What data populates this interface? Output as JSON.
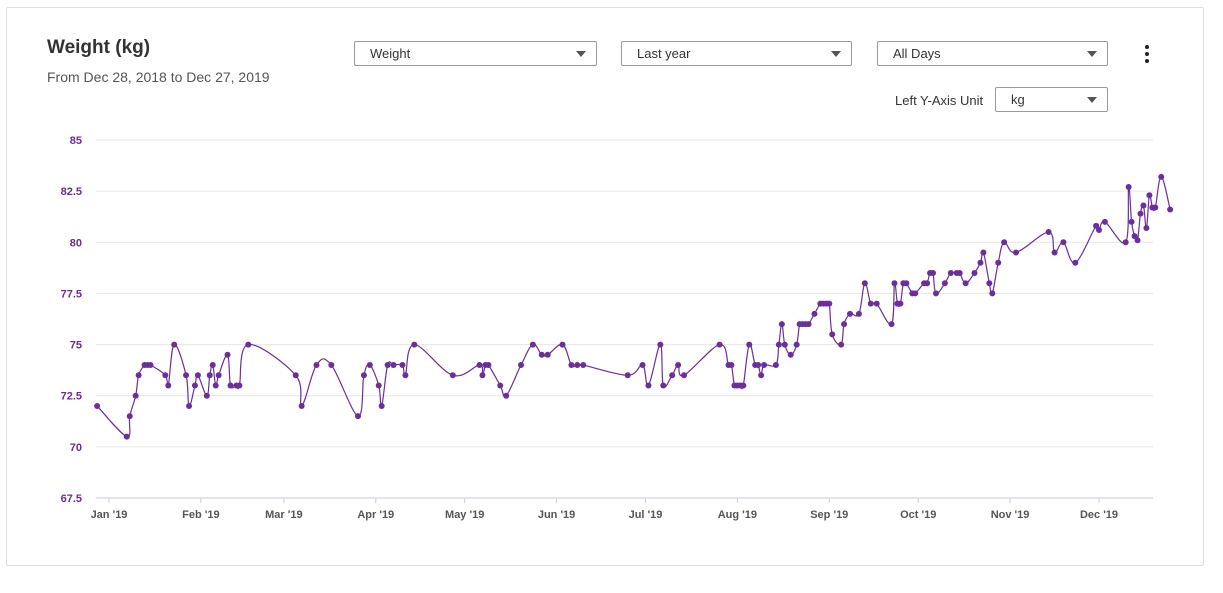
{
  "header": {
    "title": "Weight (kg)",
    "subtitle": "From Dec 28, 2018 to Dec 27, 2019"
  },
  "controls": {
    "metric": "Weight",
    "range": "Last year",
    "days": "All Days",
    "unit_label": "Left Y-Axis Unit",
    "unit": "kg"
  },
  "icons": {
    "menu": "more-vertical-icon"
  },
  "colors": {
    "series": "#6a2f9a",
    "y_ticks": "#6c2d8f",
    "grid": "#e6e6e6",
    "axis": "#c9c9e8"
  },
  "chart_data": {
    "type": "line",
    "title": "Weight (kg)",
    "ylim": [
      67.5,
      85
    ],
    "y_ticks": [
      "67.5",
      "70",
      "72.5",
      "75",
      "77.5",
      "80",
      "82.5",
      "85"
    ],
    "x_tick_labels": [
      "Jan '19",
      "Feb '19",
      "Mar '19",
      "Apr '19",
      "May '19",
      "Jun '19",
      "Jul '19",
      "Aug '19",
      "Sep '19",
      "Oct '19",
      "Nov '19",
      "Dec '19"
    ],
    "x_tick_dates": [
      "2019-01-01",
      "2019-02-01",
      "2019-03-01",
      "2019-04-01",
      "2019-05-01",
      "2019-06-01",
      "2019-07-01",
      "2019-08-01",
      "2019-09-01",
      "2019-10-01",
      "2019-11-01",
      "2019-12-01"
    ],
    "grid": true,
    "series": [
      {
        "points": [
          [
            "2018-12-28",
            72.0
          ],
          [
            "2019-01-07",
            70.5
          ],
          [
            "2019-01-08",
            71.5
          ],
          [
            "2019-01-10",
            72.5
          ],
          [
            "2019-01-11",
            73.5
          ],
          [
            "2019-01-13",
            74.0
          ],
          [
            "2019-01-14",
            74.0
          ],
          [
            "2019-01-15",
            74.0
          ],
          [
            "2019-01-20",
            73.5
          ],
          [
            "2019-01-21",
            73.0
          ],
          [
            "2019-01-23",
            75.0
          ],
          [
            "2019-01-27",
            73.5
          ],
          [
            "2019-01-28",
            72.0
          ],
          [
            "2019-01-30",
            73.0
          ],
          [
            "2019-01-31",
            73.5
          ],
          [
            "2019-02-03",
            72.5
          ],
          [
            "2019-02-04",
            73.5
          ],
          [
            "2019-02-05",
            74.0
          ],
          [
            "2019-02-06",
            73.0
          ],
          [
            "2019-02-07",
            73.5
          ],
          [
            "2019-02-10",
            74.5
          ],
          [
            "2019-02-11",
            73.0
          ],
          [
            "2019-02-13",
            73.0
          ],
          [
            "2019-02-14",
            73.0
          ],
          [
            "2019-02-17",
            75.0
          ],
          [
            "2019-03-05",
            73.5
          ],
          [
            "2019-03-07",
            72.0
          ],
          [
            "2019-03-12",
            74.0
          ],
          [
            "2019-03-17",
            74.0
          ],
          [
            "2019-03-26",
            71.5
          ],
          [
            "2019-03-28",
            73.5
          ],
          [
            "2019-03-30",
            74.0
          ],
          [
            "2019-04-02",
            73.0
          ],
          [
            "2019-04-03",
            72.0
          ],
          [
            "2019-04-05",
            74.0
          ],
          [
            "2019-04-07",
            74.0
          ],
          [
            "2019-04-10",
            74.0
          ],
          [
            "2019-04-11",
            73.5
          ],
          [
            "2019-04-14",
            75.0
          ],
          [
            "2019-04-27",
            73.5
          ],
          [
            "2019-05-06",
            74.0
          ],
          [
            "2019-05-07",
            73.5
          ],
          [
            "2019-05-08",
            74.0
          ],
          [
            "2019-05-09",
            74.0
          ],
          [
            "2019-05-13",
            73.0
          ],
          [
            "2019-05-15",
            72.5
          ],
          [
            "2019-05-20",
            74.0
          ],
          [
            "2019-05-24",
            75.0
          ],
          [
            "2019-05-27",
            74.5
          ],
          [
            "2019-05-29",
            74.5
          ],
          [
            "2019-06-03",
            75.0
          ],
          [
            "2019-06-06",
            74.0
          ],
          [
            "2019-06-08",
            74.0
          ],
          [
            "2019-06-10",
            74.0
          ],
          [
            "2019-06-25",
            73.5
          ],
          [
            "2019-06-30",
            74.0
          ],
          [
            "2019-07-02",
            73.0
          ],
          [
            "2019-07-06",
            75.0
          ],
          [
            "2019-07-07",
            73.0
          ],
          [
            "2019-07-10",
            73.5
          ],
          [
            "2019-07-12",
            74.0
          ],
          [
            "2019-07-14",
            73.5
          ],
          [
            "2019-07-26",
            75.0
          ],
          [
            "2019-07-29",
            74.0
          ],
          [
            "2019-07-30",
            74.0
          ],
          [
            "2019-07-31",
            73.0
          ],
          [
            "2019-08-01",
            73.0
          ],
          [
            "2019-08-02",
            73.0
          ],
          [
            "2019-08-03",
            73.0
          ],
          [
            "2019-08-05",
            75.0
          ],
          [
            "2019-08-07",
            74.0
          ],
          [
            "2019-08-08",
            74.0
          ],
          [
            "2019-08-09",
            73.5
          ],
          [
            "2019-08-10",
            74.0
          ],
          [
            "2019-08-14",
            74.0
          ],
          [
            "2019-08-15",
            75.0
          ],
          [
            "2019-08-16",
            76.0
          ],
          [
            "2019-08-17",
            75.0
          ],
          [
            "2019-08-19",
            74.5
          ],
          [
            "2019-08-21",
            75.0
          ],
          [
            "2019-08-22",
            76.0
          ],
          [
            "2019-08-23",
            76.0
          ],
          [
            "2019-08-24",
            76.0
          ],
          [
            "2019-08-25",
            76.0
          ],
          [
            "2019-08-27",
            76.5
          ],
          [
            "2019-08-29",
            77.0
          ],
          [
            "2019-08-30",
            77.0
          ],
          [
            "2019-08-31",
            77.0
          ],
          [
            "2019-09-01",
            77.0
          ],
          [
            "2019-09-02",
            75.5
          ],
          [
            "2019-09-05",
            75.0
          ],
          [
            "2019-09-06",
            76.0
          ],
          [
            "2019-09-08",
            76.5
          ],
          [
            "2019-09-11",
            76.5
          ],
          [
            "2019-09-13",
            78.0
          ],
          [
            "2019-09-15",
            77.0
          ],
          [
            "2019-09-17",
            77.0
          ],
          [
            "2019-09-22",
            76.0
          ],
          [
            "2019-09-23",
            78.0
          ],
          [
            "2019-09-24",
            77.0
          ],
          [
            "2019-09-25",
            77.0
          ],
          [
            "2019-09-26",
            78.0
          ],
          [
            "2019-09-27",
            78.0
          ],
          [
            "2019-09-29",
            77.5
          ],
          [
            "2019-09-30",
            77.5
          ],
          [
            "2019-10-03",
            78.0
          ],
          [
            "2019-10-04",
            78.0
          ],
          [
            "2019-10-05",
            78.5
          ],
          [
            "2019-10-06",
            78.5
          ],
          [
            "2019-10-07",
            77.5
          ],
          [
            "2019-10-10",
            78.0
          ],
          [
            "2019-10-12",
            78.5
          ],
          [
            "2019-10-14",
            78.5
          ],
          [
            "2019-10-15",
            78.5
          ],
          [
            "2019-10-17",
            78.0
          ],
          [
            "2019-10-20",
            78.5
          ],
          [
            "2019-10-22",
            79.0
          ],
          [
            "2019-10-23",
            79.5
          ],
          [
            "2019-10-25",
            78.0
          ],
          [
            "2019-10-26",
            77.5
          ],
          [
            "2019-10-28",
            79.0
          ],
          [
            "2019-10-30",
            80.0
          ],
          [
            "2019-11-03",
            79.5
          ],
          [
            "2019-11-14",
            80.5
          ],
          [
            "2019-11-16",
            79.5
          ],
          [
            "2019-11-19",
            80.0
          ],
          [
            "2019-11-23",
            79.0
          ],
          [
            "2019-11-30",
            80.8
          ],
          [
            "2019-12-01",
            80.6
          ],
          [
            "2019-12-03",
            81.0
          ],
          [
            "2019-12-10",
            80.0
          ],
          [
            "2019-12-11",
            82.7
          ],
          [
            "2019-12-12",
            81.0
          ],
          [
            "2019-12-13",
            80.3
          ],
          [
            "2019-12-14",
            80.1
          ],
          [
            "2019-12-15",
            81.4
          ],
          [
            "2019-12-16",
            81.8
          ],
          [
            "2019-12-17",
            80.7
          ],
          [
            "2019-12-18",
            82.3
          ],
          [
            "2019-12-19",
            81.7
          ],
          [
            "2019-12-20",
            81.7
          ],
          [
            "2019-12-22",
            83.2
          ],
          [
            "2019-12-25",
            81.6
          ]
        ]
      }
    ]
  }
}
